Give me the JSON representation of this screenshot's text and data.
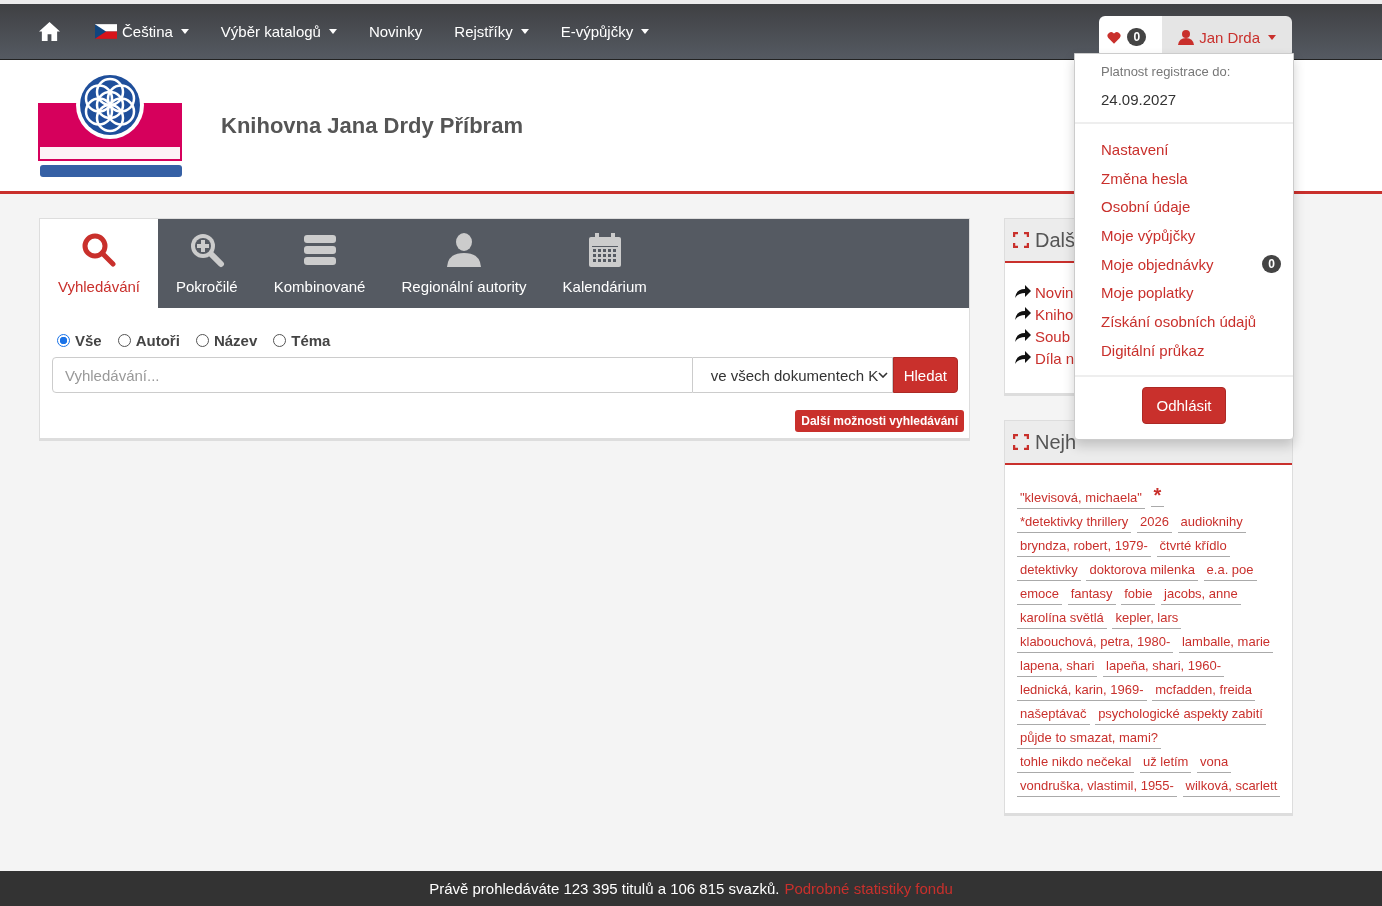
{
  "navbar": {
    "items": [
      {
        "label": "Čeština",
        "kind": "language",
        "dropdown": true
      },
      {
        "label": "Výběr katalogů",
        "kind": "menu",
        "dropdown": true
      },
      {
        "label": "Novinky",
        "kind": "menu",
        "dropdown": false
      },
      {
        "label": "Rejstříky",
        "kind": "menu",
        "dropdown": true
      },
      {
        "label": "E-výpůjčky",
        "kind": "menu",
        "dropdown": true
      }
    ],
    "favorites_count": "0",
    "user": {
      "name": "Jan Drda",
      "expanded": true
    }
  },
  "header": {
    "title": "Knihovna Jana Drdy Příbram"
  },
  "search": {
    "tabs": [
      {
        "label": "Vyhledávání",
        "selected": true
      },
      {
        "label": "Pokročilé",
        "selected": false
      },
      {
        "label": "Kombinované",
        "selected": false
      },
      {
        "label": "Regionální autority",
        "selected": false
      },
      {
        "label": "Kalendárium",
        "selected": false
      }
    ],
    "scopes": [
      {
        "label": "Vše",
        "selected": true
      },
      {
        "label": "Autoři",
        "selected": false
      },
      {
        "label": "Název",
        "selected": false
      },
      {
        "label": "Téma",
        "selected": false
      }
    ],
    "placeholder": "Vyhledávání...",
    "source": "ve všech dokumentech K",
    "button": "Hledat",
    "more": "Další možnosti vyhledávání"
  },
  "panels": [
    {
      "title": "Dalš",
      "links": [
        "Novin",
        "Kniho",
        "Soub",
        "Díla n"
      ]
    },
    {
      "title": "Nejh"
    }
  ],
  "tags": [
    {
      "label": "\"klevisová, michaela\"",
      "kind": "tag"
    },
    {
      "label": "*",
      "kind": "star"
    },
    {
      "label": "*detektivky thrillery",
      "kind": "tag"
    },
    {
      "label": "2026",
      "kind": "tag"
    },
    {
      "label": "audioknihy",
      "kind": "tag"
    },
    {
      "label": "bryndza, robert, 1979-",
      "kind": "tag"
    },
    {
      "label": "čtvrté křídlo",
      "kind": "tag"
    },
    {
      "label": "detektivky",
      "kind": "tag"
    },
    {
      "label": "doktorova milenka",
      "kind": "tag"
    },
    {
      "label": "e.a. poe",
      "kind": "tag"
    },
    {
      "label": "emoce",
      "kind": "tag"
    },
    {
      "label": "fantasy",
      "kind": "tag"
    },
    {
      "label": "fobie",
      "kind": "tag"
    },
    {
      "label": "jacobs, anne",
      "kind": "tag"
    },
    {
      "label": "karolína světlá",
      "kind": "tag"
    },
    {
      "label": "kepler, lars",
      "kind": "tag"
    },
    {
      "label": "klabouchová, petra, 1980-",
      "kind": "tag"
    },
    {
      "label": "lamballe, marie",
      "kind": "tag"
    },
    {
      "label": "lapena, shari",
      "kind": "tag"
    },
    {
      "label": "lapeňa, shari, 1960-",
      "kind": "tag"
    },
    {
      "label": "lednická, karin, 1969-",
      "kind": "tag"
    },
    {
      "label": "mcfadden, freida",
      "kind": "tag"
    },
    {
      "label": "našeptávač",
      "kind": "tag"
    },
    {
      "label": "psychologické aspekty zabití",
      "kind": "tag"
    },
    {
      "label": "půjde to smazat, mami?",
      "kind": "tag"
    },
    {
      "label": "tohle nikdo nečekal",
      "kind": "tag"
    },
    {
      "label": "už letím",
      "kind": "tag"
    },
    {
      "label": "vona",
      "kind": "tag"
    },
    {
      "label": "vondruška, vlastimil, 1955-",
      "kind": "tag"
    },
    {
      "label": "wilková, scarlett",
      "kind": "tag"
    }
  ],
  "user_menu": {
    "registration_label": "Platnost registrace do:",
    "registration_date": "24.09.2027",
    "items": [
      {
        "label": "Nastavení"
      },
      {
        "label": "Změna hesla"
      },
      {
        "label": "Osobní údaje"
      },
      {
        "label": "Moje výpůjčky"
      },
      {
        "label": "Moje objednávky",
        "badge": "0"
      },
      {
        "label": "Moje poplatky"
      },
      {
        "label": "Získání osobních údajů"
      },
      {
        "label": "Digitální průkaz"
      }
    ],
    "logout": "Odhlásit"
  },
  "footer": {
    "text": "Právě prohledáváte 123 395 titulů a 106 815 svazků.",
    "link": "Podrobné statistiky fondu"
  }
}
